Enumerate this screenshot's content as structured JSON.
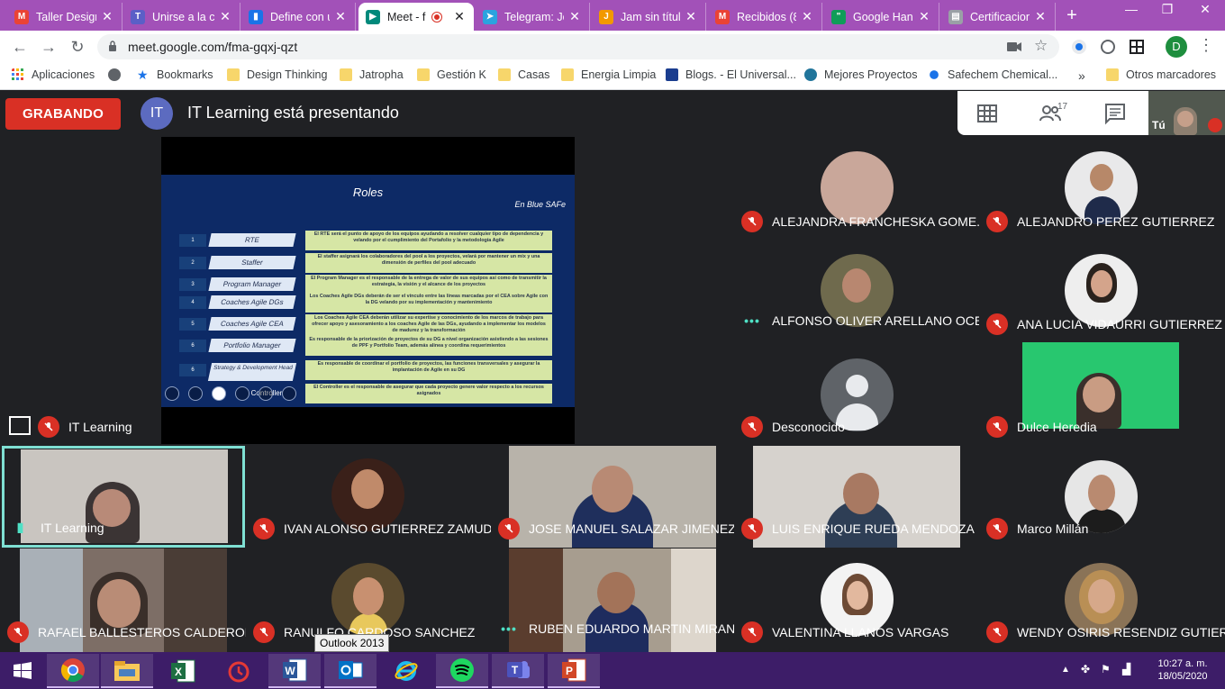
{
  "browser": {
    "tabs": [
      {
        "label": "Taller Design",
        "icon": "gmail-icon",
        "color": "#ea4335",
        "active": false
      },
      {
        "label": "Unirse a la c",
        "icon": "teams-icon",
        "color": "#5b5fc7",
        "active": false
      },
      {
        "label": "Define con u",
        "icon": "analytics-icon",
        "color": "#1a73e8",
        "active": false
      },
      {
        "label": "Meet - f",
        "icon": "meet-icon",
        "color": "#00897b",
        "active": true
      },
      {
        "label": "Telegram: Jo",
        "icon": "telegram-icon",
        "color": "#2aa3df",
        "active": false
      },
      {
        "label": "Jam sin títul",
        "icon": "jamboard-icon",
        "color": "#f29900",
        "active": false
      },
      {
        "label": "Recibidos (8",
        "icon": "gmail-icon",
        "color": "#ea4335",
        "active": false
      },
      {
        "label": "Google Han",
        "icon": "hangouts-icon",
        "color": "#0f9d58",
        "active": false
      },
      {
        "label": "Certificacion",
        "icon": "doc-icon",
        "color": "#9aa0a6",
        "active": false
      }
    ],
    "url": "meet.google.com/fma-gqxj-qzt",
    "profile_initial": "D",
    "bookmarks": [
      {
        "label": "Aplicaciones",
        "icon": "apps-grid-icon"
      },
      {
        "label": "",
        "icon": "globe-icon"
      },
      {
        "label": "Bookmarks",
        "icon": "star-icon"
      },
      {
        "label": "Design Thinking",
        "icon": "folder-icon"
      },
      {
        "label": "Jatropha",
        "icon": "folder-icon"
      },
      {
        "label": "Gestión K",
        "icon": "folder-icon"
      },
      {
        "label": "Casas",
        "icon": "folder-icon"
      },
      {
        "label": "Energia Limpia",
        "icon": "folder-icon"
      },
      {
        "label": "Blogs. - El Universal...",
        "icon": "eu-logo-icon"
      },
      {
        "label": "Mejores Proyectos",
        "icon": "wordpress-icon"
      },
      {
        "label": "Safechem Chemical...",
        "icon": "molecule-icon"
      }
    ],
    "bookmarks_overflow": "»",
    "other_bookmarks": "Otros marcadores"
  },
  "meet": {
    "recording_label": "GRABANDO",
    "presenter_initials": "IT",
    "presenting_text": "IT Learning está presentando",
    "participant_count": "17",
    "self_label": "Tú",
    "presentation_tile_name": "IT Learning",
    "slide": {
      "title": "Roles",
      "subtitle": "En Blue SAFe",
      "rows": [
        {
          "num": "1",
          "role": "RTE",
          "desc": "El RTE será el punto de apoyo de los equipos ayudando a resolver cualquier tipo de dependencia y velando por el cumplimiento del Portafolio y la metodología Agile"
        },
        {
          "num": "2",
          "role": "Staffer",
          "desc": "El staffer asignará los colaboradores del pool a los proyectos, velará por mantener un mix y una dimensión de perfiles del pool adecuado"
        },
        {
          "num": "3",
          "role": "Program Manager",
          "desc": "El Program Manager es el responsable de la entrega de valor de sus equipos así como de transmitir la estrategia, la visión y el alcance de los proyectos"
        },
        {
          "num": "4",
          "role": "Coaches Agile DGs",
          "desc": "Los Coaches Agile DGs deberán de ser el vínculo entre las líneas marcadas por el CEA sobre Agile con la DG velando por su implementación y mantenimiento"
        },
        {
          "num": "5",
          "role": "Coaches Agile CEA",
          "desc": "Los Coaches Agile CEA deberán utilizar su expertise y conocimiento de los marcos de trabajo para ofrecer apoyo y asesoramiento a los coaches Agile de las DGs, ayudando a implementar los modelos de madurez y la transformación"
        },
        {
          "num": "6",
          "role": "Portfolio Manager",
          "desc": "Es responsable de la priorización de proyectos de su DG a nivel organización asistiendo a las sesiones de PPF y Portfolio Team, además alinea y coordina requerimientos"
        },
        {
          "num": "6",
          "role": "Strategy & Development Head",
          "desc": "Es responsable de coordinar el portfolio de proyectos, las funciones transversales y asegurar la implantación de Agile en su DG"
        },
        {
          "num": "",
          "role": "Controller",
          "desc": "El Controller es el responsable de asegurar que cada proyecto genere valor respecto a los recursos asignados"
        }
      ]
    },
    "participants_right": [
      {
        "name": "ALEJANDRA FRANCHESKA GOME...",
        "status": "muted"
      },
      {
        "name": "ALEJANDRO PEREZ GUTIERREZ",
        "status": "muted"
      },
      {
        "name": "ALFONSO OLIVER ARELLANO OCE...",
        "status": "speaking"
      },
      {
        "name": "ANA LUCIA VIDAURRI GUTIERREZ",
        "status": "muted"
      },
      {
        "name": "Desconocido",
        "status": "muted"
      },
      {
        "name": "Dulce Heredia",
        "status": "muted"
      }
    ],
    "participants_bottom": [
      {
        "name": "IT Learning",
        "status": "speaking"
      },
      {
        "name": "IVAN ALONSO GUTIERREZ ZAMUDIO",
        "status": "muted"
      },
      {
        "name": "JOSE MANUEL SALAZAR JIMENEZ",
        "status": "muted"
      },
      {
        "name": "LUIS ENRIQUE RUEDA MENDOZA",
        "status": "muted"
      },
      {
        "name": "Marco Millán",
        "status": "muted"
      },
      {
        "name": "RAFAEL BALLESTEROS CALDERON",
        "status": "muted"
      },
      {
        "name": "RANULFO CARDOSO SANCHEZ",
        "status": "muted"
      },
      {
        "name": "RUBEN EDUARDO MARTIN MIRAN...",
        "status": "speaking"
      },
      {
        "name": "VALENTINA LLANOS VARGAS",
        "status": "muted"
      },
      {
        "name": "WENDY OSIRIS RESENDIZ GUTIER...",
        "status": "muted"
      }
    ]
  },
  "taskbar": {
    "apps": [
      {
        "name": "windows-start-icon"
      },
      {
        "name": "chrome-icon"
      },
      {
        "name": "file-explorer-icon"
      },
      {
        "name": "excel-icon"
      },
      {
        "name": "alarms-clock-icon"
      },
      {
        "name": "word-icon"
      },
      {
        "name": "outlook-icon"
      },
      {
        "name": "internet-explorer-icon"
      },
      {
        "name": "spotify-icon"
      },
      {
        "name": "teams-icon"
      },
      {
        "name": "powerpoint-icon"
      }
    ],
    "tooltip": "Outlook 2013",
    "time": "10:27 a. m.",
    "date": "18/05/2020"
  }
}
